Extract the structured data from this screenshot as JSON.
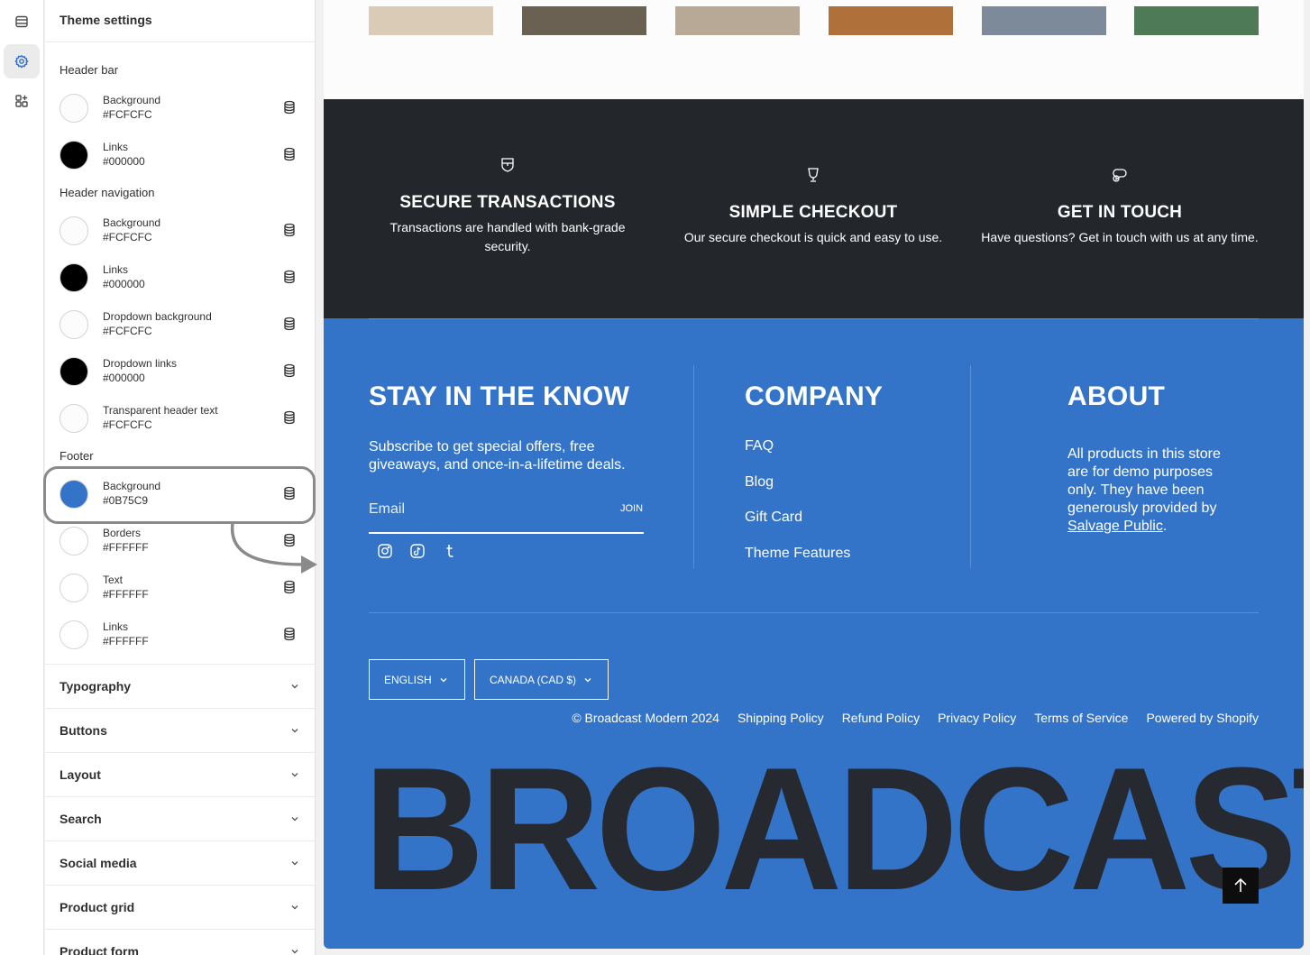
{
  "rail": {
    "items": [
      "sections-icon",
      "gear-icon",
      "apps-icon"
    ],
    "active": 1
  },
  "panel": {
    "title": "Theme settings",
    "groups": [
      {
        "label": "Header bar",
        "items": [
          {
            "name": "Background",
            "hex": "#FCFCFC",
            "color": "#FCFCFC"
          },
          {
            "name": "Links",
            "hex": "#000000",
            "color": "#000000"
          }
        ]
      },
      {
        "label": "Header navigation",
        "items": [
          {
            "name": "Background",
            "hex": "#FCFCFC",
            "color": "#FCFCFC"
          },
          {
            "name": "Links",
            "hex": "#000000",
            "color": "#000000"
          },
          {
            "name": "Dropdown background",
            "hex": "#FCFCFC",
            "color": "#FCFCFC"
          },
          {
            "name": "Dropdown links",
            "hex": "#000000",
            "color": "#000000"
          },
          {
            "name": "Transparent header text",
            "hex": "#FCFCFC",
            "color": "#FCFCFC"
          }
        ]
      },
      {
        "label": "Footer",
        "items": [
          {
            "name": "Background",
            "hex": "#0B75C9",
            "color": "#3474C8"
          },
          {
            "name": "Borders",
            "hex": "#FFFFFF",
            "color": "#FFFFFF"
          },
          {
            "name": "Text",
            "hex": "#FFFFFF",
            "color": "#FFFFFF"
          },
          {
            "name": "Links",
            "hex": "#FFFFFF",
            "color": "#FFFFFF"
          }
        ]
      }
    ],
    "accordions": [
      "Typography",
      "Buttons",
      "Layout",
      "Search",
      "Social media",
      "Product grid",
      "Product form"
    ]
  },
  "preview": {
    "thumb_colors": [
      "#d9cbb6",
      "#6b6152",
      "#b7a996",
      "#b0703a",
      "#7c8a9a",
      "#4e7a58"
    ],
    "trust": [
      {
        "icon": "shield-icon",
        "title": "SECURE TRANSACTIONS",
        "text": "Transactions are handled with bank-grade security."
      },
      {
        "icon": "trophy-icon",
        "title": "SIMPLE CHECKOUT",
        "text": "Our secure checkout is quick and easy to use."
      },
      {
        "icon": "chat-icon",
        "title": "GET IN TOUCH",
        "text": "Have questions? Get in touch with us at any time."
      }
    ],
    "footer": {
      "newsletter_title": "STAY IN THE KNOW",
      "newsletter_text": "Subscribe to get special offers, free giveaways, and once-in-a-lifetime deals.",
      "email_placeholder": "Email",
      "join_label": "JOIN",
      "company_title": "COMPANY",
      "company_links": [
        "FAQ",
        "Blog",
        "Gift Card",
        "Theme Features"
      ],
      "about_title": "ABOUT",
      "about_text": "All products in this store are for demo purposes only. They have been generously provided by",
      "about_link": "Salvage Public",
      "about_end": ".",
      "language": "ENGLISH",
      "currency": "CANADA (CAD $)",
      "legal": [
        "© Broadcast Modern 2024",
        "Shipping Policy",
        "Refund Policy",
        "Privacy Policy",
        "Terms of Service",
        "Powered by Shopify"
      ],
      "wordmark": "BROADCAST"
    }
  }
}
